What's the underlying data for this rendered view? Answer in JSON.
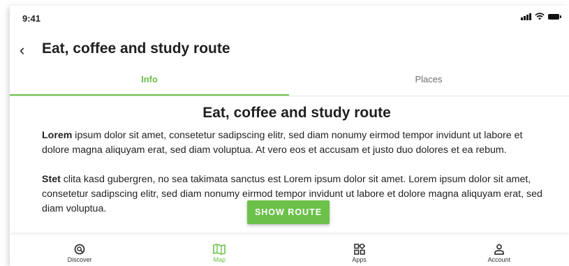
{
  "status_bar": {
    "time": "9:41"
  },
  "header": {
    "back_label": "‹",
    "title": "Eat, coffee and study route"
  },
  "tabs": [
    {
      "label": "Info",
      "active": true
    },
    {
      "label": "Places",
      "active": false
    }
  ],
  "content": {
    "heading": "Eat, coffee and study route",
    "paragraph1_bold": "Lorem",
    "paragraph1_text": " ipsum dolor sit amet, consetetur sadipscing elitr, sed diam nonumy eirmod tempor invidunt ut labore et dolore magna aliquyam erat, sed diam voluptua. At vero eos et accusam et justo duo dolores et ea rebum.",
    "paragraph2_bold": "Stet",
    "paragraph2_text": " clita kasd gubergren, no sea takimata sanctus est Lorem ipsum dolor sit amet. Lorem ipsum dolor sit amet, consetetur sadipscing elitr, sed diam nonumy eirmod tempor invidunt ut labore et dolore magna aliquyam erat, sed diam voluptua."
  },
  "show_route_button": {
    "label": "SHOW ROUTE"
  },
  "bottom_nav": [
    {
      "label": "Discover",
      "icon": "discover-icon",
      "active": false
    },
    {
      "label": "Map",
      "icon": "map-icon",
      "active": true
    },
    {
      "label": "Apps",
      "icon": "apps-icon",
      "active": false
    },
    {
      "label": "Account",
      "icon": "account-icon",
      "active": false
    }
  ],
  "colors": {
    "accent": "#6cc14a",
    "text": "#1f1f1f",
    "muted": "#6f6f6f"
  }
}
